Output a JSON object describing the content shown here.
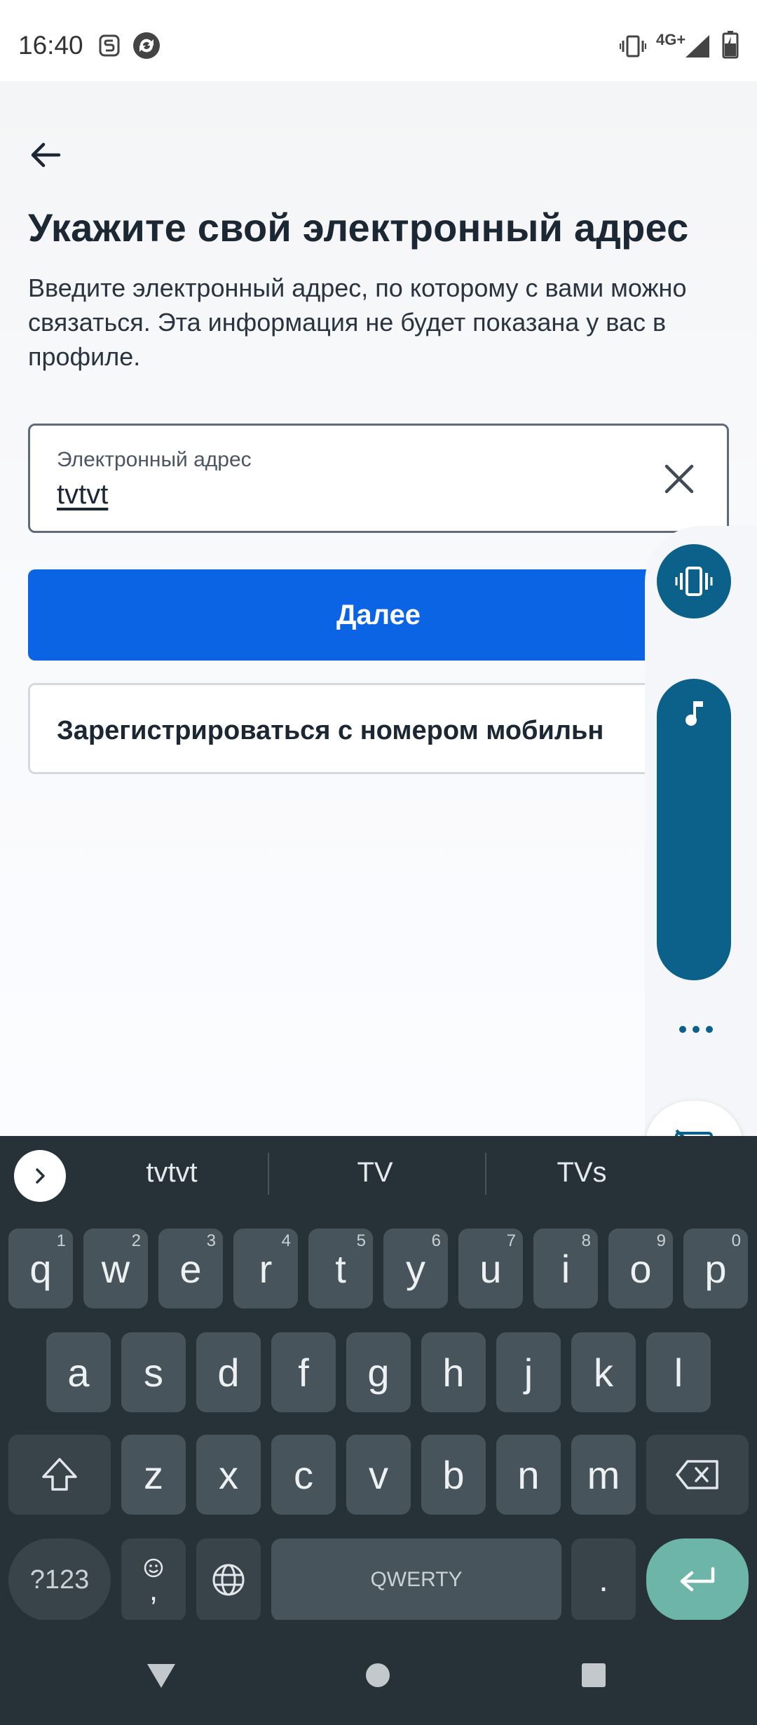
{
  "status_bar": {
    "time": "16:40",
    "left_icons": [
      "notification-s-icon",
      "sync-icon"
    ],
    "network": "4G+",
    "right_icons": [
      "vibrate-icon",
      "signal-icon",
      "battery-charging-icon"
    ]
  },
  "screen": {
    "back_icon": "arrow-left-icon",
    "title": "Укажите свой электронный адрес",
    "description": "Введите электронный адрес, по которому с вами можно связаться. Эта информация не будет показана у вас в профиле.",
    "email_field": {
      "label": "Электронный адрес",
      "value": "tvtvt",
      "clear_icon": "close-icon"
    },
    "next_button": "Далее",
    "register_phone_button": "Зарегистрироваться с номером мобильн"
  },
  "volume_panel": {
    "mode_icon": "vibrate-icon",
    "slider_icon": "music-note-icon",
    "more_icon": "more-horizontal-icon",
    "captions_icon": "captions-off-icon",
    "accent": "#0b6189"
  },
  "keyboard": {
    "suggestions": [
      "tvtvt",
      "TV",
      "TVs"
    ],
    "row1": [
      [
        "q",
        "1"
      ],
      [
        "w",
        "2"
      ],
      [
        "e",
        "3"
      ],
      [
        "r",
        "4"
      ],
      [
        "t",
        "5"
      ],
      [
        "y",
        "6"
      ],
      [
        "u",
        "7"
      ],
      [
        "i",
        "8"
      ],
      [
        "o",
        "9"
      ],
      [
        "p",
        "0"
      ]
    ],
    "row2": [
      "a",
      "s",
      "d",
      "f",
      "g",
      "h",
      "j",
      "k",
      "l"
    ],
    "row3": [
      "z",
      "x",
      "c",
      "v",
      "b",
      "n",
      "m"
    ],
    "symbols_key": "?123",
    "emoji_comma": ",",
    "space_label": "QWERTY",
    "period": ".",
    "accent": "#6cb5a8"
  },
  "nav_bar": {
    "icons": [
      "back-triangle-icon",
      "home-circle-icon",
      "recents-square-icon"
    ]
  },
  "colors": {
    "primary": "#0a64e3",
    "text": "#1b2733",
    "keyboard_bg": "#273238"
  }
}
